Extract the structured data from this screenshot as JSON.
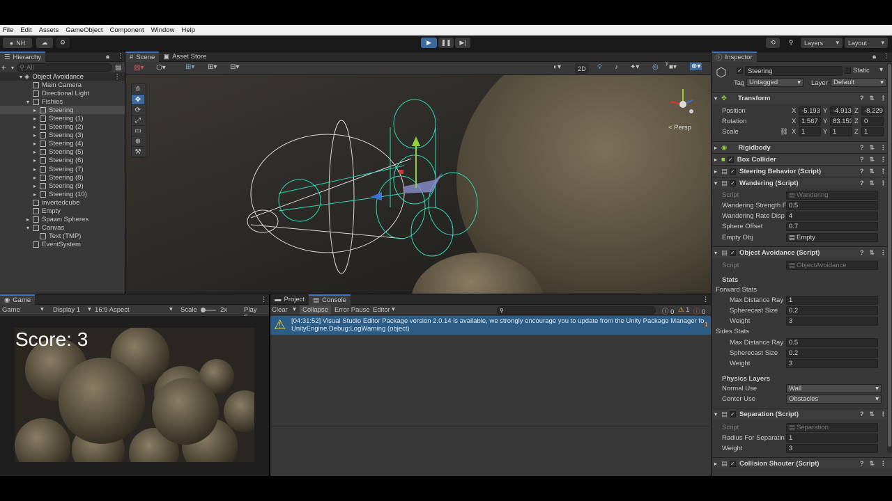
{
  "menu": [
    "File",
    "Edit",
    "Assets",
    "GameObject",
    "Component",
    "Window",
    "Help"
  ],
  "toolbar": {
    "account": "NH",
    "layers": "Layers",
    "layout": "Layout"
  },
  "hierarchy": {
    "tab": "Hierarchy",
    "search_placeholder": "All",
    "scene": "Object Avoidance",
    "items": [
      {
        "label": "Main Camera",
        "depth": 1
      },
      {
        "label": "Directional Light",
        "depth": 1
      },
      {
        "label": "Fishies",
        "depth": 1
      },
      {
        "label": "Steering",
        "depth": 2
      },
      {
        "label": "Steering (1)",
        "depth": 2
      },
      {
        "label": "Steering (2)",
        "depth": 2
      },
      {
        "label": "Steering (3)",
        "depth": 2
      },
      {
        "label": "Steering (4)",
        "depth": 2
      },
      {
        "label": "Steering (5)",
        "depth": 2
      },
      {
        "label": "Steering (6)",
        "depth": 2
      },
      {
        "label": "Steering (7)",
        "depth": 2
      },
      {
        "label": "Steering (8)",
        "depth": 2
      },
      {
        "label": "Steering (9)",
        "depth": 2
      },
      {
        "label": "Steering (10)",
        "depth": 2
      },
      {
        "label": "invertedcube",
        "depth": 1
      },
      {
        "label": "Empty",
        "depth": 1
      },
      {
        "label": "Spawn Spheres",
        "depth": 1
      },
      {
        "label": "Canvas",
        "depth": 1
      },
      {
        "label": "Text (TMP)",
        "depth": 2
      },
      {
        "label": "EventSystem",
        "depth": 1
      }
    ]
  },
  "scene": {
    "tab_scene": "Scene",
    "tab_store": "Asset Store",
    "mode_2d": "2D",
    "persp": "< Persp"
  },
  "game": {
    "tab": "Game",
    "display_select": "Game",
    "display": "Display 1",
    "aspect": "16:9 Aspect",
    "scale_label": "Scale",
    "scale_value": "2x",
    "play_focus": "Play Foc",
    "score": "Score: 3"
  },
  "console": {
    "tab_project": "Project",
    "tab_console": "Console",
    "clear": "Clear",
    "collapse": "Collapse",
    "error_pause": "Error Pause",
    "editor": "Editor",
    "count_info": "0",
    "count_warn": "1",
    "count_err": "0",
    "message_line1": "[04:31:52] Visual Studio Editor Package version 2.0.14 is available, we strongly encourage you to update from the Unity Package Manager fo",
    "message_line2": "UnityEngine.Debug:LogWarning (object)",
    "message_count": "1"
  },
  "inspector": {
    "tab": "Inspector",
    "object_name": "Steering",
    "static": "Static",
    "tag_label": "Tag",
    "tag_value": "Untagged",
    "layer_label": "Layer",
    "layer_value": "Default",
    "transform": {
      "title": "Transform",
      "position": {
        "label": "Position",
        "x": "-5.193",
        "y": "-4.913",
        "z": "-8.229"
      },
      "rotation": {
        "label": "Rotation",
        "x": "1.567",
        "y": "83.153",
        "z": "0"
      },
      "scale": {
        "label": "Scale",
        "x": "1",
        "y": "1",
        "z": "1"
      }
    },
    "rigidbody": "Rigidbody",
    "box_collider": "Box Collider",
    "steering_behavior": "Steering Behavior (Script)",
    "wandering": {
      "title": "Wandering (Script)",
      "script_label": "Script",
      "script_value": "Wandering",
      "strength_label": "Wandering Strength F",
      "strength_value": "0.5",
      "rate_label": "Wandering Rate Disp",
      "rate_value": "4",
      "offset_label": "Sphere Offset",
      "offset_value": "0.7",
      "empty_label": "Empty Obj",
      "empty_value": "Empty"
    },
    "avoidance": {
      "title": "Object Avoidance (Script)",
      "script_label": "Script",
      "script_value": "ObjectAvoidance",
      "stats": "Stats",
      "forward": "Forward Stats",
      "f_max_label": "Max Distance Ray",
      "f_max": "1",
      "f_sphere_label": "Spherecast Size",
      "f_sphere": "0.2",
      "f_weight_label": "Weight",
      "f_weight": "3",
      "sides": "Sides Stats",
      "s_max_label": "Max Distance Ray",
      "s_max": "0.5",
      "s_sphere_label": "Spherecast Size",
      "s_sphere": "0.2",
      "s_weight_label": "Weight",
      "s_weight": "3",
      "physics": "Physics Layers",
      "normal_label": "Normal Use",
      "normal_value": "Wall",
      "center_label": "Center Use",
      "center_value": "Obstacles"
    },
    "separation": {
      "title": "Separation (Script)",
      "script_label": "Script",
      "script_value": "Separation",
      "radius_label": "Radius For Separatin",
      "radius_value": "1",
      "weight_label": "Weight",
      "weight_value": "3"
    },
    "collision": "Collision Shouter (Script)"
  },
  "colors": {
    "accent": "#3a79bb",
    "panel": "#383838",
    "warning": "#f4c430"
  }
}
